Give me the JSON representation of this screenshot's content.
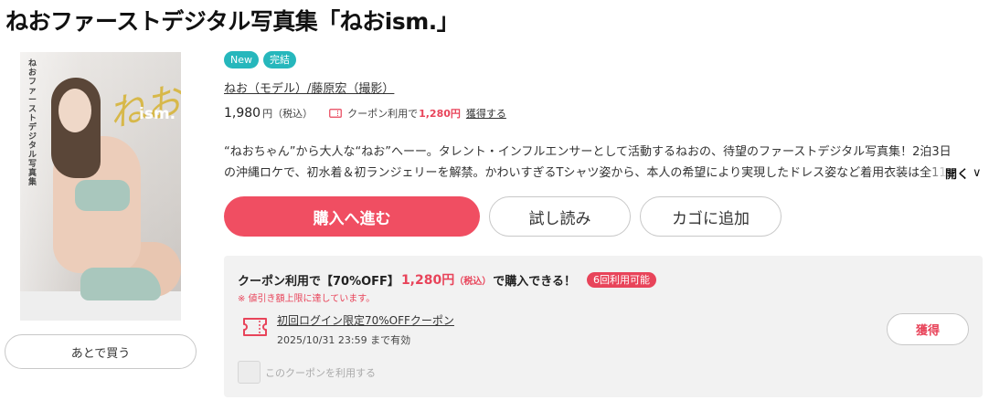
{
  "product": {
    "title": "ねおファーストデジタル写真集「ねおism.」",
    "badges": [
      "New",
      "完結"
    ],
    "authors": "ねお（モデル）/藤原宏（撮影）",
    "price": "1,980",
    "price_unit": "円（税込）",
    "coupon_text": "クーポン利用で",
    "coupon_price": "1,280円",
    "get_link": "獲得する",
    "description": "“ねおちゃん”から大人な“ねお”へーー。タレント・インフルエンサーとして活動するねおの、待望のファーストデジタル写真集！2泊3日の沖縄ロケで、初水着＆初ランジェリーを解禁。かわいすぎるTシャツ姿から、本人の希望により実現したドレス姿など着用衣装は全11着！　開",
    "open_label": "開く",
    "chevron": "∨"
  },
  "cover": {
    "vertical_text": "ねおファーストデジタル写真集",
    "logo_script": "ねお",
    "logo_text": "ism."
  },
  "buttons": {
    "later": "あとで買う",
    "buy": "購入へ進む",
    "sample": "試し読み",
    "cart": "カゴに追加"
  },
  "coupon_box": {
    "head_prefix": "クーポン利用で【70%OFF】",
    "price": "1,280円",
    "tax": "（税込）",
    "head_suffix": "で購入できる！",
    "uses_badge": "6回利用可能",
    "note": "※ 値引き額上限に達しています。",
    "coupon_name": "初回ログイン限定70%OFFクーポン",
    "expiry": "2025/10/31 23:59 まで有効",
    "get_button": "獲得",
    "checkbox_label": "このクーポンを利用する"
  },
  "colors": {
    "accent": "#f04e62",
    "badge": "#26b7bc",
    "coupon_red": "#e8445a",
    "panel_bg": "#f2f2f2"
  }
}
